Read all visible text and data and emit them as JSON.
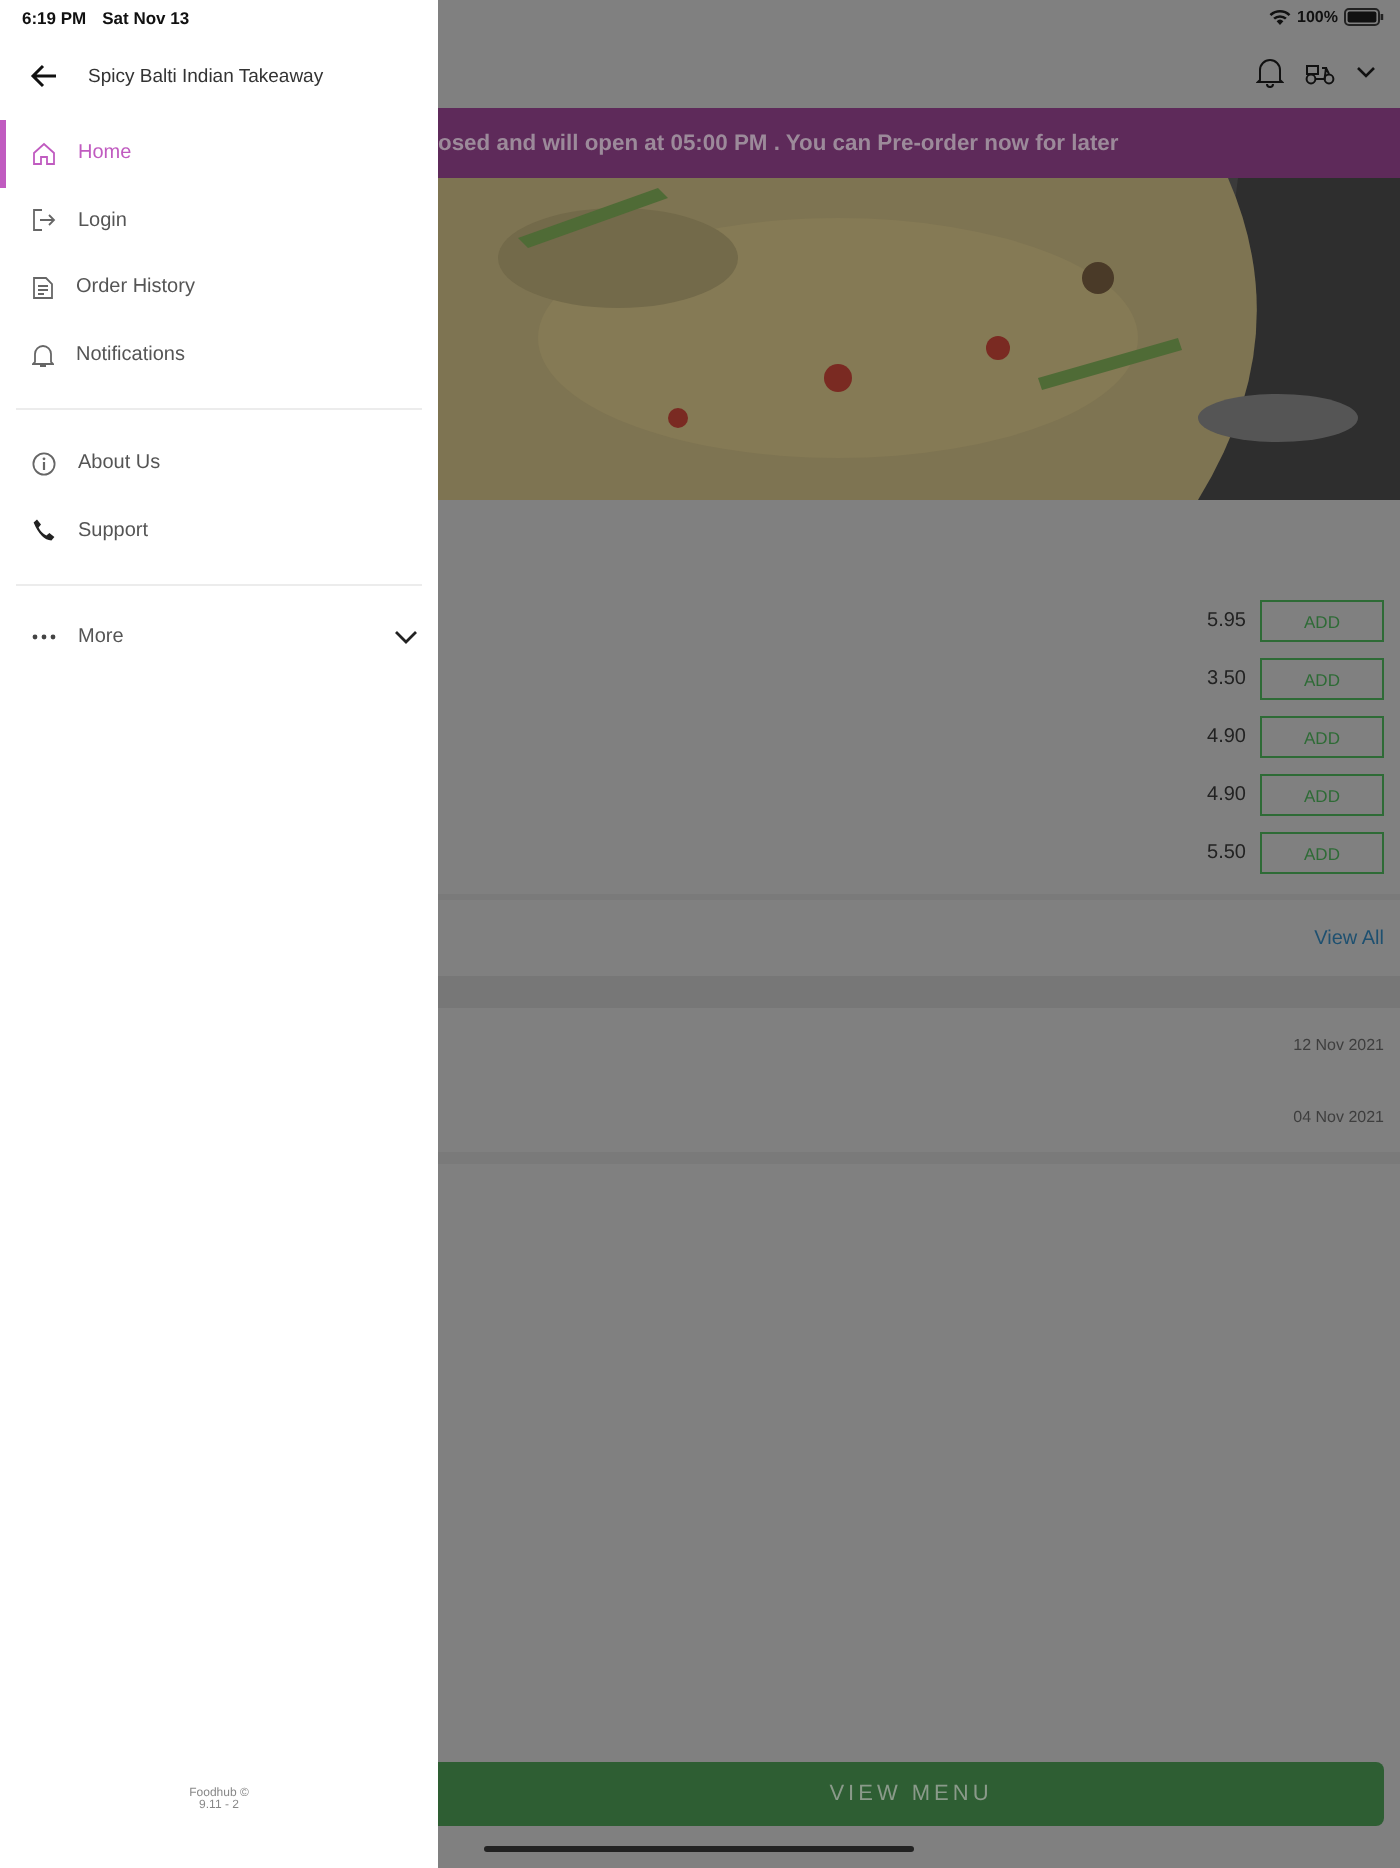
{
  "status_bar": {
    "time": "6:19 PM",
    "date": "Sat Nov 13",
    "battery": "100%"
  },
  "drawer": {
    "title": "Spicy Balti Indian Takeaway",
    "sections": [
      {
        "items": [
          {
            "label": "Home",
            "kind": "home",
            "selected": true
          },
          {
            "label": "Login",
            "kind": "login",
            "selected": false
          },
          {
            "label": "Order History",
            "kind": "receipt",
            "selected": false
          },
          {
            "label": "Notifications",
            "kind": "bell",
            "selected": false
          }
        ]
      },
      {
        "items": [
          {
            "label": "About Us",
            "kind": "info",
            "selected": false
          },
          {
            "label": "Support",
            "kind": "phone",
            "selected": false
          }
        ]
      }
    ],
    "more": {
      "label": "More",
      "expanded": false
    },
    "footer": [
      "Foodhub ©",
      "9.11 - 2"
    ]
  },
  "banner": "osed and will open at 05:00 PM . You can Pre-order now for later",
  "menu_items": [
    {
      "price": "5.95",
      "button": "ADD"
    },
    {
      "price": "3.50",
      "button": "ADD"
    },
    {
      "price": "4.90",
      "button": "ADD"
    },
    {
      "price": "4.90",
      "button": "ADD"
    },
    {
      "price": "5.50",
      "button": "ADD"
    }
  ],
  "view_all": "View All",
  "orders": [
    {
      "date": "12 Nov 2021"
    },
    {
      "date": "04 Nov 2021"
    }
  ],
  "view_menu": "VIEW MENU"
}
